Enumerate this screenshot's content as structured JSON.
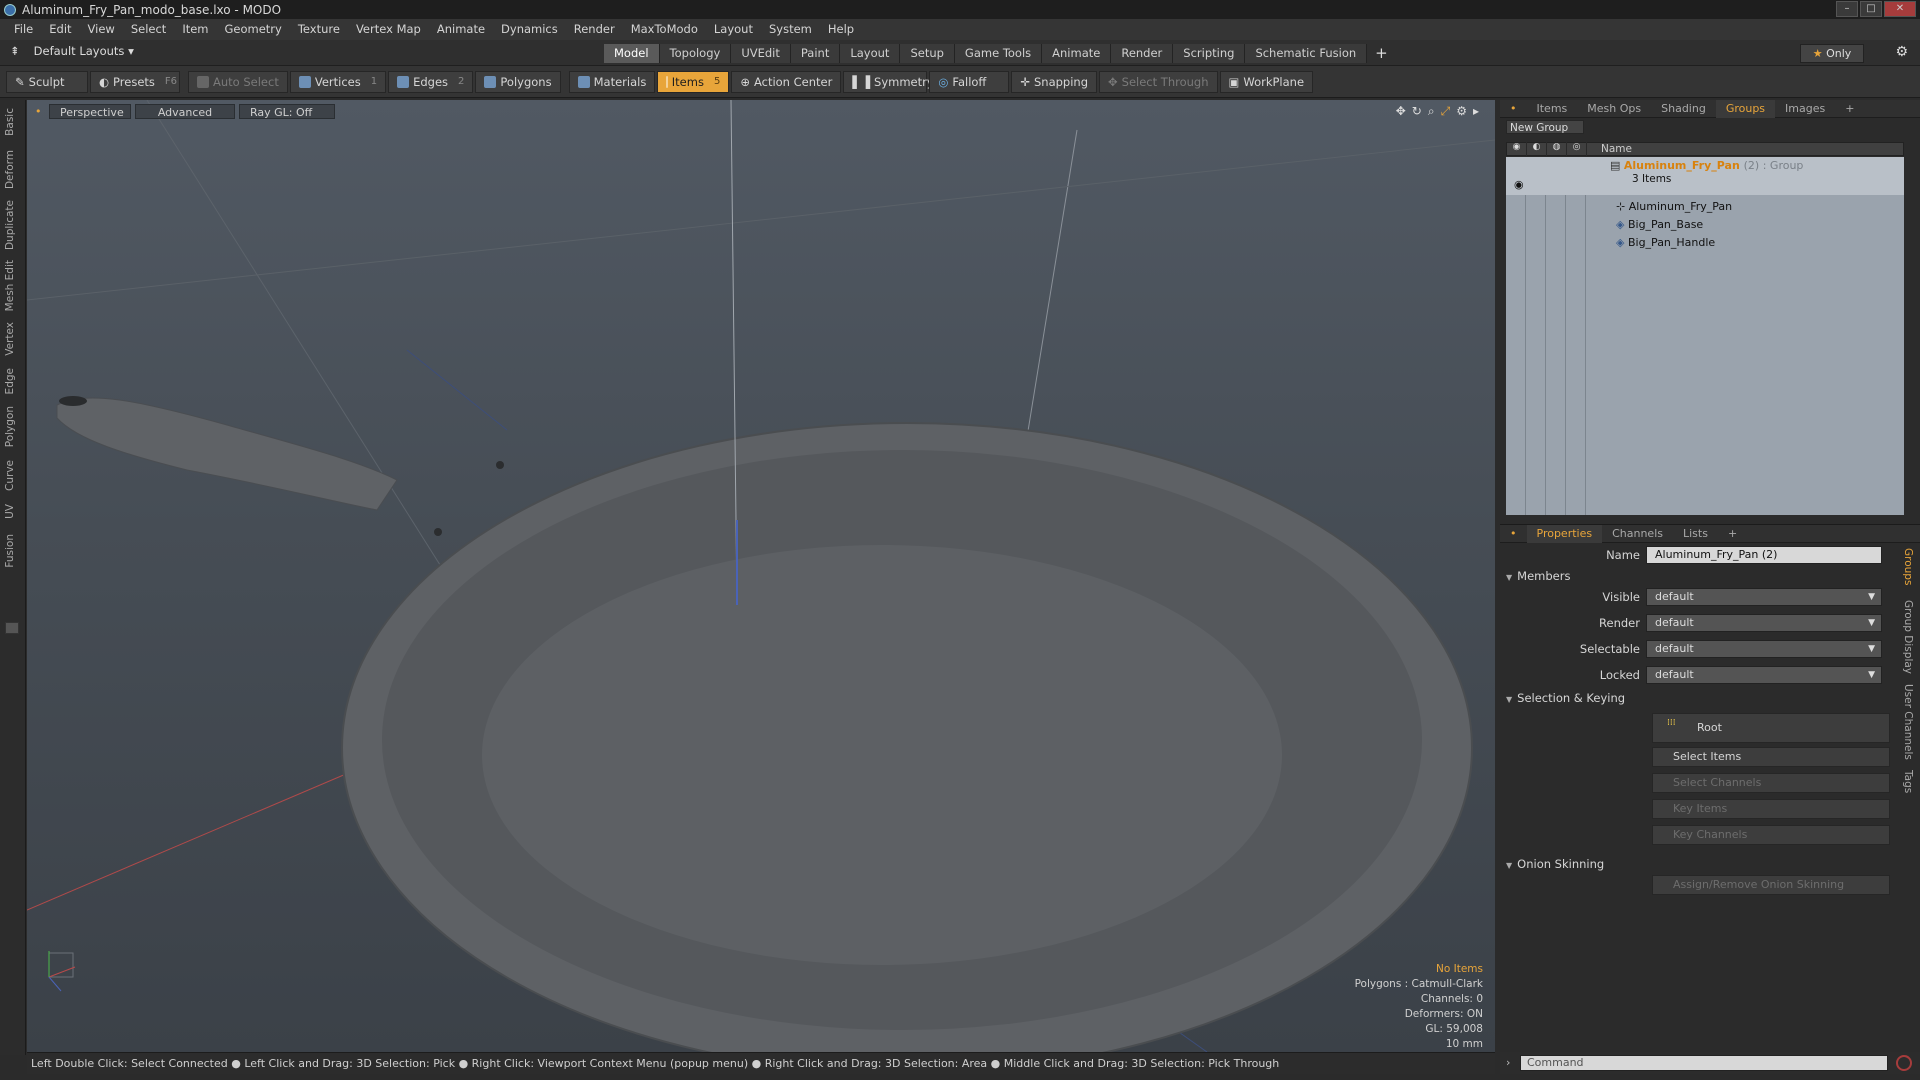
{
  "window": {
    "title": "Aluminum_Fry_Pan_modo_base.lxo - MODO",
    "min": "–",
    "max": "□",
    "close": "✕"
  },
  "menu": [
    "File",
    "Edit",
    "View",
    "Select",
    "Item",
    "Geometry",
    "Texture",
    "Vertex Map",
    "Animate",
    "Dynamics",
    "Render",
    "MaxToModo",
    "Layout",
    "System",
    "Help"
  ],
  "layouts": {
    "label": "Default Layouts"
  },
  "tabs": [
    {
      "label": "Model",
      "active": true
    },
    {
      "label": "Topology"
    },
    {
      "label": "UVEdit"
    },
    {
      "label": "Paint"
    },
    {
      "label": "Layout"
    },
    {
      "label": "Setup"
    },
    {
      "label": "Game Tools"
    },
    {
      "label": "Animate"
    },
    {
      "label": "Render"
    },
    {
      "label": "Scripting"
    },
    {
      "label": "Schematic Fusion"
    }
  ],
  "only": "Only",
  "toolbar": {
    "sculpt": "Sculpt",
    "presets": "Presets",
    "presets_key": "F6",
    "auto_select": "Auto Select",
    "vertices": "Vertices",
    "vertices_n": "1",
    "edges": "Edges",
    "edges_n": "2",
    "polygons": "Polygons",
    "materials": "Materials",
    "items": "Items",
    "items_n": "5",
    "action_center": "Action Center",
    "symmetry": "Symmetry",
    "falloff": "Falloff",
    "snapping": "Snapping",
    "select_through": "Select Through",
    "workplane": "WorkPlane"
  },
  "lefttabs": [
    "Basic",
    "Deform",
    "Duplicate",
    "Mesh Edit",
    "Vertex",
    "Edge",
    "Polygon",
    "Curve",
    "UV",
    "Fusion"
  ],
  "viewport": {
    "perspective": "Perspective",
    "advanced": "Advanced",
    "raygl": "Ray GL: Off",
    "info": {
      "no_items": "No Items",
      "polygons": "Polygons : Catmull-Clark",
      "channels": "Channels: 0",
      "deformers": "Deformers: ON",
      "gl": "GL: 59,008",
      "scale": "10 mm"
    }
  },
  "status": "Left Double Click: Select Connected ● Left Click and Drag: 3D Selection: Pick ● Right Click: Viewport Context Menu (popup menu) ● Right Click and Drag: 3D Selection: Area ● Middle Click and Drag: 3D Selection: Pick Through",
  "grouppanel": {
    "tabs": [
      "Items",
      "Mesh Ops",
      "Shading",
      "Groups",
      "Images"
    ],
    "active": "Groups",
    "new_group": "New Group",
    "col_name": "Name",
    "group": {
      "name": "Aluminum_Fry_Pan",
      "suffix": "(2) : Group",
      "count": "3 Items"
    },
    "children": [
      "Aluminum_Fry_Pan",
      "Big_Pan_Base",
      "Big_Pan_Handle"
    ]
  },
  "properties": {
    "tabs": [
      "Properties",
      "Channels",
      "Lists"
    ],
    "name_label": "Name",
    "name_value": "Aluminum_Fry_Pan (2)",
    "members": "Members",
    "visible": "Visible",
    "render": "Render",
    "selectable": "Selectable",
    "locked": "Locked",
    "default": "default",
    "sel_keying": "Selection & Keying",
    "root": "Root",
    "select_items": "Select Items",
    "select_channels": "Select Channels",
    "key_items": "Key Items",
    "key_channels": "Key Channels",
    "onion": "Onion Skinning",
    "assign_onion": "Assign/Remove Onion Skinning"
  },
  "rightvtabs": [
    "Groups",
    "Group Display",
    "User Channels",
    "Tags"
  ],
  "command": {
    "placeholder": "Command"
  }
}
